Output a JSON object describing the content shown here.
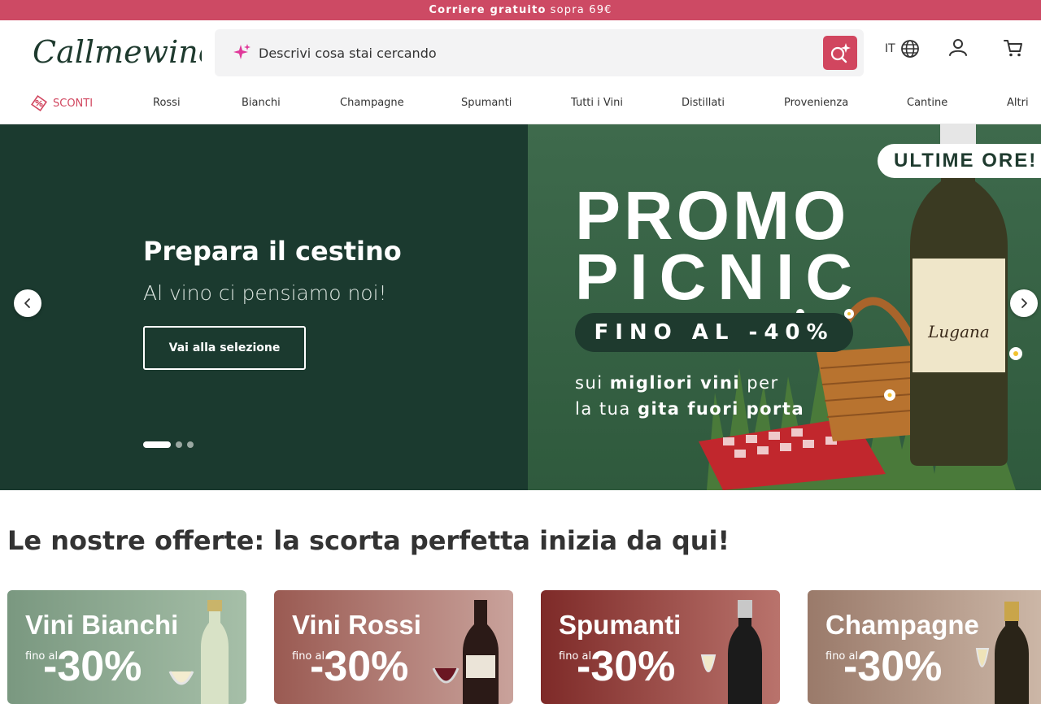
{
  "topbar": {
    "strong": "Corriere gratuito",
    "light": "sopra 69€"
  },
  "header": {
    "logo_text": "Callmewine",
    "search": {
      "placeholder": "Descrivi cosa stai cercando"
    },
    "language": "IT",
    "icons": {
      "search": "ai-search-icon",
      "language": "globe-icon",
      "account": "user-icon",
      "cart": "cart-icon",
      "spark": "sparkle-icon"
    }
  },
  "nav": {
    "items": [
      {
        "label": "SCONTI"
      },
      {
        "label": "Rossi"
      },
      {
        "label": "Bianchi"
      },
      {
        "label": "Champagne"
      },
      {
        "label": "Spumanti"
      },
      {
        "label": "Tutti i Vini"
      },
      {
        "label": "Distillati"
      },
      {
        "label": "Provenienza"
      },
      {
        "label": "Cantine"
      },
      {
        "label": "Altri"
      }
    ]
  },
  "hero": {
    "title": "Prepara il cestino",
    "subtitle": "Al vino ci pensiamo noi!",
    "cta": "Vai alla selezione",
    "slides_total": 3,
    "active_slide": 1,
    "banner": {
      "line1": "PROMO",
      "line2": "PICNIC",
      "pill": "FINO AL -40%",
      "text_a1": "sui ",
      "text_a2": "migliori vini",
      "text_a3": " per",
      "text_b1": "la tua ",
      "text_b2": "gita fuori porta",
      "badge": "ULTIME ORE!",
      "bottle_label": "Lugana"
    }
  },
  "offers": {
    "title": "Le nostre offerte: la scorta perfetta inizia da qui!",
    "cards": [
      {
        "title": "Vini Bianchi",
        "fino": "fino al",
        "discount": "-30%"
      },
      {
        "title": "Vini Rossi",
        "fino": "fino al",
        "discount": "-30%"
      },
      {
        "title": "Spumanti",
        "fino": "fino al",
        "discount": "-30%"
      },
      {
        "title": "Champagne",
        "fino": "fino al",
        "discount": "-30%"
      }
    ]
  },
  "colors": {
    "brand": "#cd4a64",
    "hero_dark": "#1b3a2f",
    "hero_green": "#3f6b4d"
  }
}
